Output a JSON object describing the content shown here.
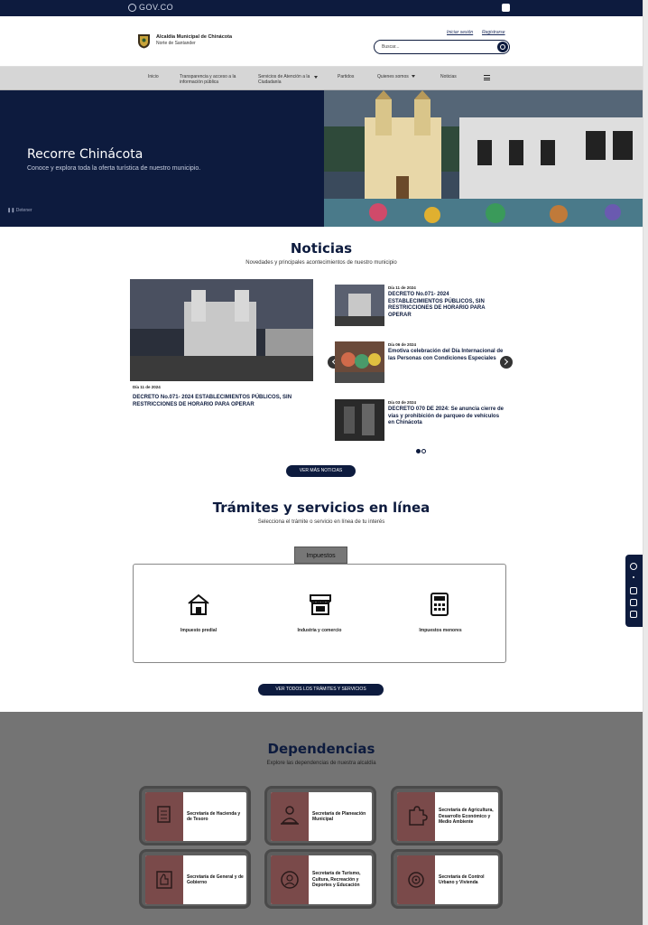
{
  "topbar": {
    "brand": "GOV.CO"
  },
  "header": {
    "entity_name": "Alcaldía Municipal de Chinácota",
    "region": "Norte de Santander",
    "login_label": "Iniciar sesión",
    "register_label": "Registrarse",
    "search_placeholder": "Buscar..."
  },
  "nav": {
    "items": [
      {
        "label": "Inicio"
      },
      {
        "label": "Transparencia y acceso a la información pública"
      },
      {
        "label": "Servicios de Atención a la Ciudadanía"
      },
      {
        "label": "Partidos"
      },
      {
        "label": "Quienes somos"
      },
      {
        "label": "Noticias"
      }
    ]
  },
  "hero": {
    "title": "Recorre Chinácota",
    "subtitle": "Conoce y explora toda la oferta turística de nuestro municipio.",
    "pause_label": "Detener"
  },
  "news": {
    "title": "Noticias",
    "subtitle": "Novedades y principales acontecimientos de nuestro municipio",
    "featured": {
      "date": "Día 11 de 2024",
      "title": "DECRETO No.071- 2024 ESTABLECIMIENTOS PÚBLICOS, SIN RESTRICCIONES DE HORARIO PARA OPERAR"
    },
    "items": [
      {
        "date": "Día 11 de 2024",
        "title": "DECRETO No.071- 2024 ESTABLECIMIENTOS PÚBLICOS, SIN RESTRICCIONES DE HORARIO PARA OPERAR"
      },
      {
        "date": "Día 06 de 2024",
        "title": "Emotiva celebración del Día Internacional de las Personas con Condiciones Especiales"
      },
      {
        "date": "Día 03 de 2024",
        "title": "DECRETO 070 DE 2024: Se anuncia cierre de vías y prohibición de parqueo de vehículos en Chinácota"
      }
    ],
    "more_label": "VER MÁS NOTICIAS"
  },
  "services": {
    "title": "Trámites y servicios en línea",
    "subtitle": "Selecciona el trámite o servicio en línea de tu interés",
    "active_tab": "Impuestos",
    "items": [
      {
        "label": "Impuesto predial",
        "icon": "house-icon"
      },
      {
        "label": "Industria y comercio",
        "icon": "store-icon"
      },
      {
        "label": "Impuestos menores",
        "icon": "calculator-icon"
      }
    ],
    "all_label": "VER TODOS LOS TRÁMITES Y SERVICIOS"
  },
  "departments": {
    "title": "Dependencias",
    "subtitle": "Explore las dependencias de nuestra alcaldía",
    "items": [
      {
        "label": "Secretaría de Hacienda y de Tesoro",
        "icon": "document-icon"
      },
      {
        "label": "Secretaría de Planeación Municipal",
        "icon": "person-desk-icon"
      },
      {
        "label": "Secretaría de Agricultura, Desarrollo Económico y Medio Ambiente",
        "icon": "puzzle-icon"
      },
      {
        "label": "Secretaría de General y de Gobierno",
        "icon": "thumbs-up-icon"
      },
      {
        "label": "Secretaría de Turismo, Cultura, Recreación y Deportes y Educación",
        "icon": "globe-person-icon"
      },
      {
        "label": "Secretaría de Control Urbano y Vivienda",
        "icon": "target-icon"
      }
    ]
  },
  "colors": {
    "primary": "#0d1b3e",
    "accent": "#7a4a4a",
    "section_gray": "#747474"
  }
}
